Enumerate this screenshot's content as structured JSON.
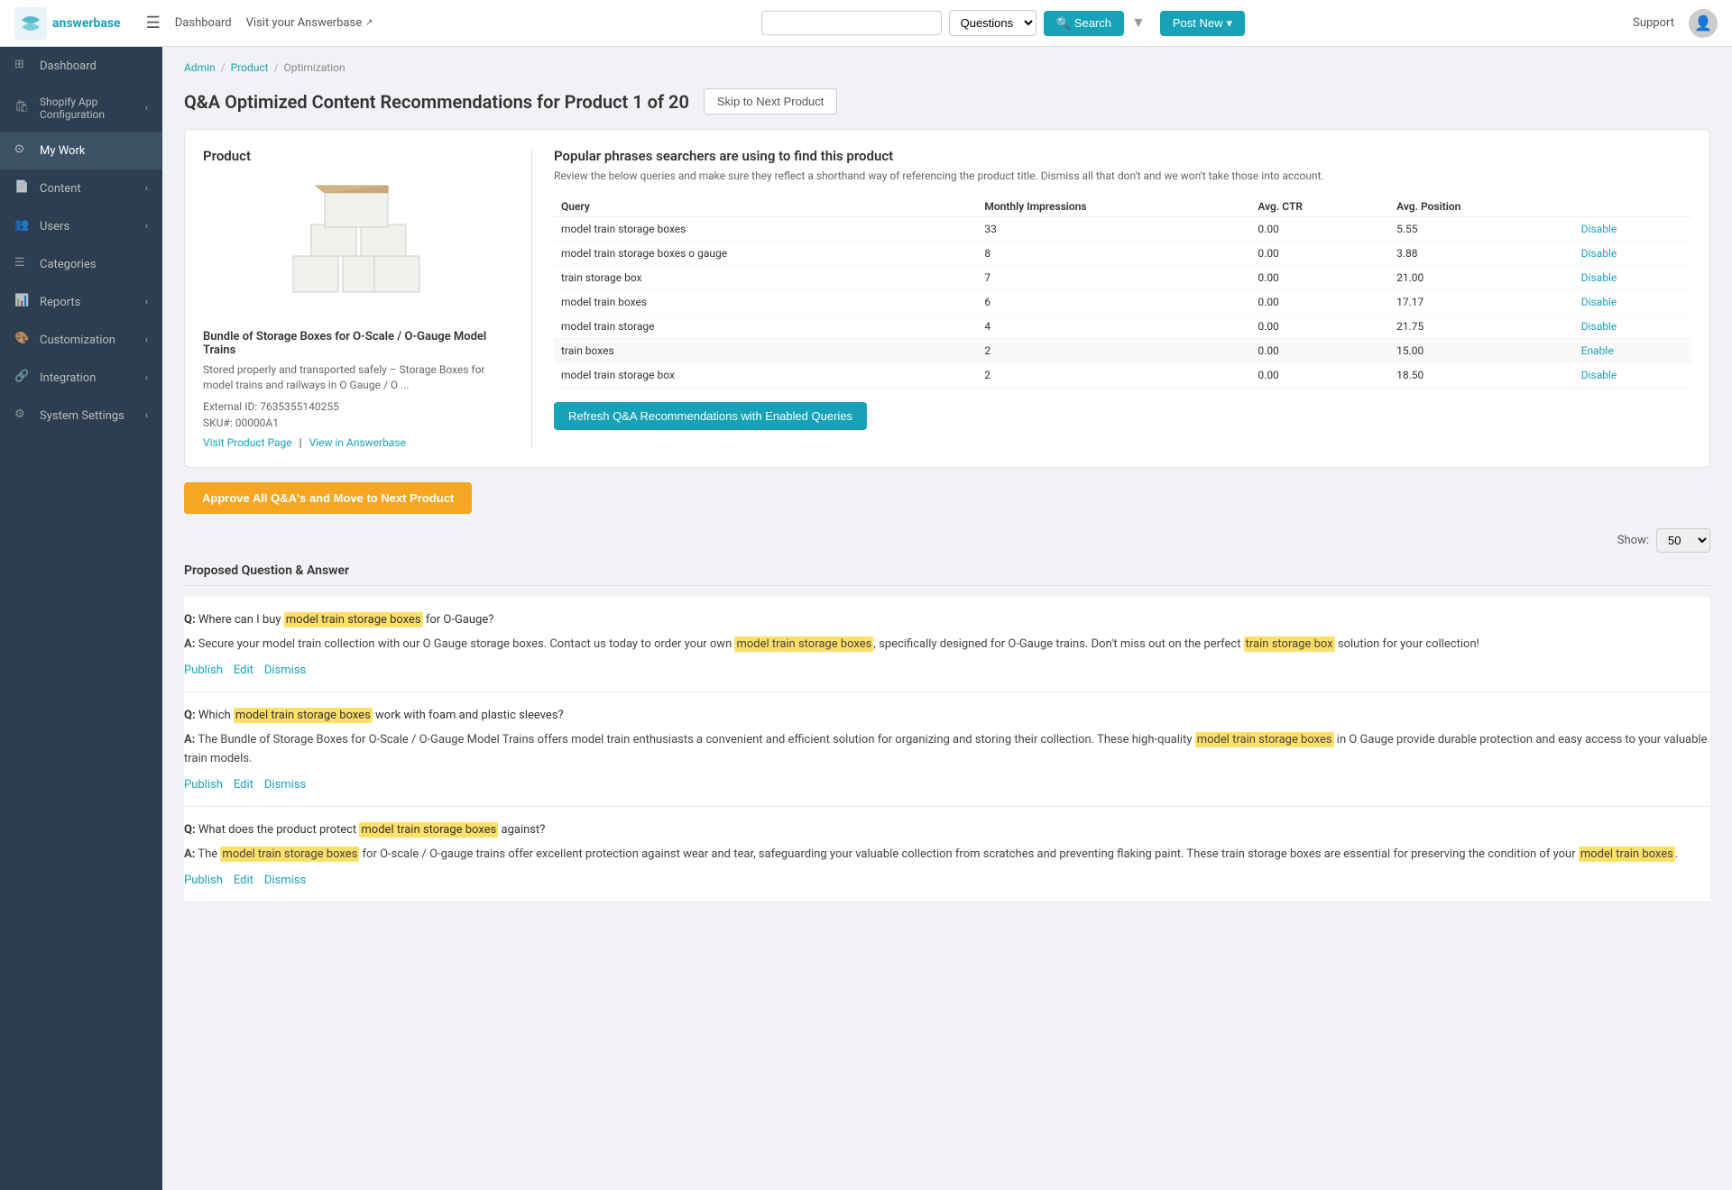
{
  "topnav": {
    "dashboard_label": "Dashboard",
    "visit_label": "Visit your Answerbase",
    "search_placeholder": "",
    "search_type": "Questions",
    "search_btn": "Search",
    "post_new_btn": "Post New",
    "support_label": "Support"
  },
  "sidebar": {
    "items": [
      {
        "id": "dashboard",
        "label": "Dashboard",
        "icon": "dashboard-icon",
        "has_arrow": false
      },
      {
        "id": "shopify-app",
        "label": "Shopify App Configuration",
        "icon": "shopify-icon",
        "has_arrow": true
      },
      {
        "id": "my-work",
        "label": "My Work",
        "icon": "work-icon",
        "has_arrow": false
      },
      {
        "id": "content",
        "label": "Content",
        "icon": "content-icon",
        "has_arrow": true
      },
      {
        "id": "users",
        "label": "Users",
        "icon": "users-icon",
        "has_arrow": true
      },
      {
        "id": "categories",
        "label": "Categories",
        "icon": "categories-icon",
        "has_arrow": false
      },
      {
        "id": "reports",
        "label": "Reports",
        "icon": "reports-icon",
        "has_arrow": true
      },
      {
        "id": "customization",
        "label": "Customization",
        "icon": "customization-icon",
        "has_arrow": true
      },
      {
        "id": "integration",
        "label": "Integration",
        "icon": "integration-icon",
        "has_arrow": true
      },
      {
        "id": "system-settings",
        "label": "System Settings",
        "icon": "settings-icon",
        "has_arrow": true
      }
    ]
  },
  "breadcrumb": {
    "items": [
      "Admin",
      "Product",
      "Optimization"
    ]
  },
  "page": {
    "title": "Q&A Optimized Content Recommendations for Product 1 of 20",
    "skip_btn": "Skip to Next Product",
    "approve_btn": "Approve All Q&A's and Move to Next Product",
    "show_label": "Show:",
    "show_value": "50",
    "qa_section_title": "Proposed Question & Answer"
  },
  "product": {
    "panel_title": "Product",
    "name": "Bundle of Storage Boxes for O-Scale / O-Gauge Model Trains",
    "description": "Stored properly and transported safely – Storage Boxes for model trains and railways in O Gauge / O ...",
    "external_id": "External ID: 7635355140255",
    "sku": "SKU#: 00000A1",
    "visit_link": "Visit Product Page",
    "view_link": "View in Answerbase"
  },
  "queries": {
    "panel_title": "Popular phrases searchers are using to find this product",
    "panel_desc": "Review the below queries and make sure they reflect a shorthand way of referencing the product title. Dismiss all that don't and we won't take those into account.",
    "table_headers": [
      "Query",
      "Monthly Impressions",
      "Avg. CTR",
      "Avg. Position",
      ""
    ],
    "rows": [
      {
        "query": "model train storage boxes",
        "impressions": 33,
        "ctr": "0.00",
        "position": "5.55",
        "action": "Disable",
        "action_type": "disable",
        "highlighted": false
      },
      {
        "query": "model train storage boxes o gauge",
        "impressions": 8,
        "ctr": "0.00",
        "position": "3.88",
        "action": "Disable",
        "action_type": "disable",
        "highlighted": false
      },
      {
        "query": "train storage box",
        "impressions": 7,
        "ctr": "0.00",
        "position": "21.00",
        "action": "Disable",
        "action_type": "disable",
        "highlighted": false
      },
      {
        "query": "model train boxes",
        "impressions": 6,
        "ctr": "0.00",
        "position": "17.17",
        "action": "Disable",
        "action_type": "disable",
        "highlighted": false
      },
      {
        "query": "model train storage",
        "impressions": 4,
        "ctr": "0.00",
        "position": "21.75",
        "action": "Disable",
        "action_type": "disable",
        "highlighted": false
      },
      {
        "query": "train boxes",
        "impressions": 2,
        "ctr": "0.00",
        "position": "15.00",
        "action": "Enable",
        "action_type": "enable",
        "highlighted": true
      },
      {
        "query": "model train storage box",
        "impressions": 2,
        "ctr": "0.00",
        "position": "18.50",
        "action": "Disable",
        "action_type": "disable",
        "highlighted": false
      }
    ],
    "refresh_btn": "Refresh Q&A Recommendations with Enabled Queries"
  },
  "qa_items": [
    {
      "question_plain": "Where can I buy ",
      "question_highlight": "model train storage boxes",
      "question_suffix": " for O-Gauge?",
      "answer_parts": [
        {
          "text": "Secure your model train collection with our O Gauge storage boxes. Contact us today to order your own "
        },
        {
          "text": "model train storage boxes",
          "highlight": true
        },
        {
          "text": ", specifically designed for O-Gauge trains. Don't miss out on the perfect "
        },
        {
          "text": "train storage box",
          "highlight": true
        },
        {
          "text": " solution for your collection!"
        }
      ],
      "publish_label": "Publish",
      "edit_label": "Edit",
      "dismiss_label": "Dismiss"
    },
    {
      "question_plain": "Which ",
      "question_highlight": "model train storage boxes",
      "question_suffix": " work with foam and plastic sleeves?",
      "answer_parts": [
        {
          "text": "The Bundle of Storage Boxes for O-Scale / O-Gauge Model Trains offers model train enthusiasts a convenient and efficient solution for organizing and storing their collection. These high-quality "
        },
        {
          "text": "model train storage boxes",
          "highlight": true
        },
        {
          "text": " in O Gauge provide durable protection and easy access to your valuable train models."
        }
      ],
      "publish_label": "Publish",
      "edit_label": "Edit",
      "dismiss_label": "Dismiss"
    },
    {
      "question_plain": "What does the product protect ",
      "question_highlight": "model train storage boxes",
      "question_suffix": " against?",
      "answer_parts": [
        {
          "text": "The "
        },
        {
          "text": "model train storage boxes",
          "highlight": true
        },
        {
          "text": " for O-scale / O-gauge trains offer excellent protection against wear and tear, safeguarding your valuable collection from scratches and preventing flaking paint. These train storage boxes are essential for preserving the condition of your "
        },
        {
          "text": "model train boxes",
          "highlight": true
        },
        {
          "text": "."
        }
      ],
      "publish_label": "Publish",
      "edit_label": "Edit",
      "dismiss_label": "Dismiss"
    }
  ]
}
